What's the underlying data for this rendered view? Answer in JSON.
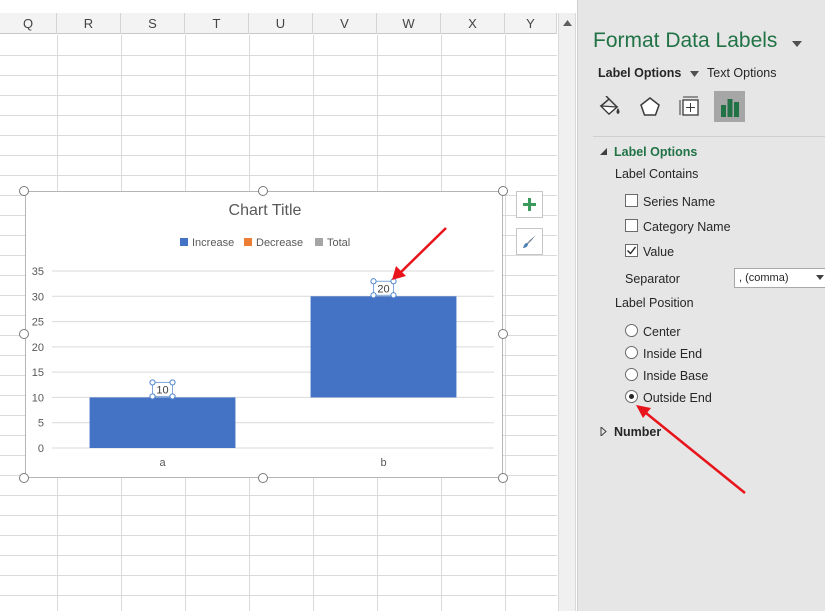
{
  "sheet": {
    "columns": [
      "Q",
      "R",
      "S",
      "T",
      "U",
      "V",
      "W",
      "X",
      "Y"
    ]
  },
  "chart_data": {
    "type": "bar",
    "title": "Chart Title",
    "categories": [
      "a",
      "b"
    ],
    "series": [
      {
        "name": "Increase",
        "color": "#4472c4",
        "bases": [
          0,
          10
        ],
        "values": [
          10,
          20
        ]
      },
      {
        "name": "Decrease",
        "color": "#ed7d31",
        "values": []
      },
      {
        "name": "Total",
        "color": "#a5a5a5",
        "values": []
      }
    ],
    "data_labels": [
      "10",
      "20"
    ],
    "ylim": [
      0,
      35
    ],
    "yticks": [
      "0",
      "5",
      "10",
      "15",
      "20",
      "25",
      "30",
      "35"
    ],
    "legend": "top",
    "grid": true
  },
  "chart_buttons": {
    "add_element_icon": "plus-icon",
    "styles_icon": "paintbrush-icon"
  },
  "pane": {
    "title": "Format Data Labels",
    "tabs": [
      {
        "label": "Label Options",
        "active": true
      },
      {
        "label": "Text Options",
        "active": false
      }
    ],
    "icons": [
      "paint-bucket-icon",
      "pentagon-icon",
      "size-properties-icon",
      "bar-chart-icon"
    ],
    "accent": "#217346",
    "sections": {
      "label_options": {
        "header": "Label Options",
        "label_contains": "Label Contains",
        "checkboxes": [
          {
            "label": "Series Name",
            "checked": false
          },
          {
            "label": "Category Name",
            "checked": false
          },
          {
            "label": "Value",
            "checked": true
          }
        ],
        "separator_label": "Separator",
        "separator_value": ", (comma)",
        "label_position": "Label Position",
        "positions": [
          {
            "label": "Center",
            "selected": false
          },
          {
            "label": "Inside End",
            "selected": false
          },
          {
            "label": "Inside Base",
            "selected": false
          },
          {
            "label": "Outside End",
            "selected": true
          }
        ]
      },
      "number": {
        "header": "Number"
      }
    }
  },
  "annotation_color": "#e8141b"
}
